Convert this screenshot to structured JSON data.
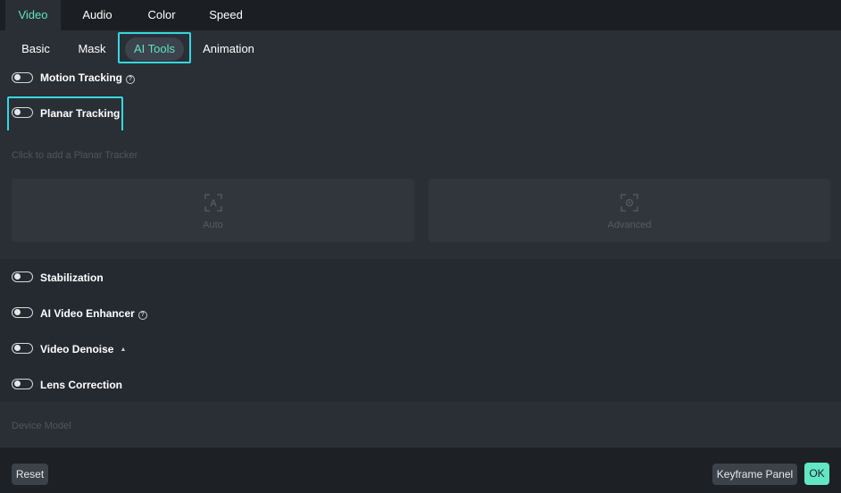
{
  "top_tabs": [
    {
      "label": "Video",
      "active": true
    },
    {
      "label": "Audio",
      "active": false
    },
    {
      "label": "Color",
      "active": false
    },
    {
      "label": "Speed",
      "active": false
    }
  ],
  "sub_tabs": [
    {
      "label": "Basic",
      "active": false
    },
    {
      "label": "Mask",
      "active": false
    },
    {
      "label": "AI Tools",
      "active": true
    },
    {
      "label": "Animation",
      "active": false
    }
  ],
  "features": {
    "motion_tracking": {
      "label": "Motion Tracking",
      "enabled": false,
      "help_icon": "help-circle-icon"
    },
    "planar_tracking": {
      "label": "Planar Tracking",
      "enabled": false
    },
    "stabilization": {
      "label": "Stabilization",
      "enabled": false
    },
    "ai_video_enhancer": {
      "label": "AI Video Enhancer",
      "enabled": false,
      "help_icon": "help-circle-icon"
    },
    "video_denoise": {
      "label": "Video Denoise",
      "enabled": false,
      "caret_icon": "caret-up-icon"
    },
    "lens_correction": {
      "label": "Lens Correction",
      "enabled": false
    }
  },
  "planar_panel": {
    "hint": "Click to add a Planar Tracker",
    "auto_label": "Auto",
    "advanced_label": "Advanced"
  },
  "device_model_label": "Device Model",
  "footer": {
    "reset_label": "Reset",
    "keyframe_panel_label": "Keyframe Panel",
    "ok_label": "OK"
  },
  "colors": {
    "accent": "#5de3c1",
    "highlight": "#36d7e0",
    "ok_button": "#63e6c4",
    "background": "#252a30"
  },
  "help_glyph": "?",
  "caret_glyph": "▲"
}
